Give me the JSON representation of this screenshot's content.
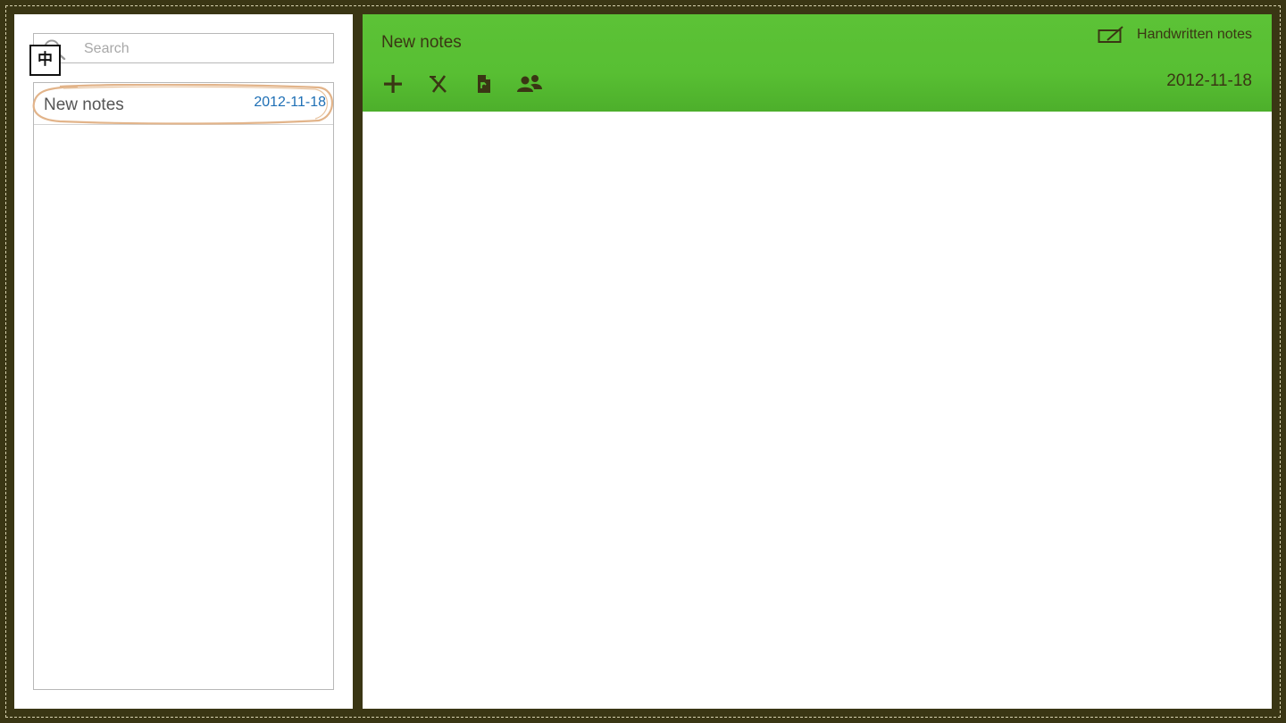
{
  "search": {
    "placeholder": "Search",
    "value": ""
  },
  "ime": {
    "label": "中"
  },
  "notes_list": [
    {
      "title": "New notes",
      "date": "2012-11-18",
      "selected": true
    }
  ],
  "note": {
    "title": "New notes",
    "date": "2012-11-18",
    "body": ""
  },
  "handwritten": {
    "label": "Handwritten notes",
    "icon": "pen-tablet-icon"
  },
  "toolbar": {
    "icons": [
      "add-icon",
      "delete-icon",
      "export-file-icon",
      "share-users-icon"
    ]
  },
  "colors": {
    "frame": "#3a3614",
    "stitch": "#d8d2b0",
    "header_green": "#58bf33",
    "date_link_blue": "#1e6fb5",
    "highlight_ring": "#e2b48a",
    "icon_dark": "#3a3614"
  }
}
